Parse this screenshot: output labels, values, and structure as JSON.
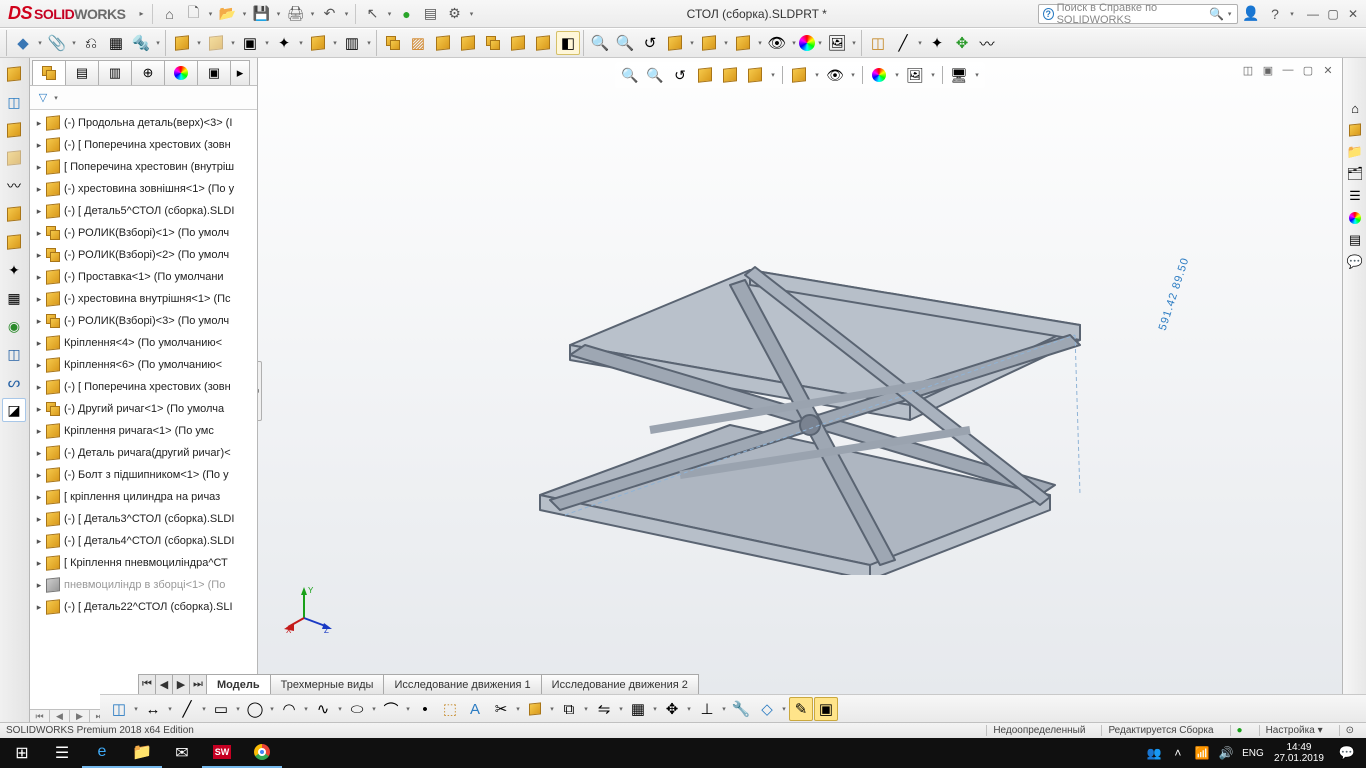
{
  "app": {
    "brand_solid": "SOLID",
    "brand_works": "WORKS",
    "title": "СТОЛ (сборка).SLDPRT *",
    "search_placeholder": "Поиск в Справке по SOLIDWORKS"
  },
  "tree": {
    "items": [
      {
        "t": "(-) Продольна деталь(верх)<3> (I",
        "asm": false
      },
      {
        "t": "(-) [ Поперечина хрестових (зовн",
        "asm": false
      },
      {
        "t": "[ Поперечина хрестовин (внутріш",
        "asm": false
      },
      {
        "t": "(-) хрестовина зовнішня<1> (По у",
        "asm": false
      },
      {
        "t": "(-) [ Деталь5^СТОЛ (сборка).SLDI",
        "asm": false
      },
      {
        "t": "(-) РОЛИК(Взборі)<1> (По умолч",
        "asm": true
      },
      {
        "t": "(-) РОЛИК(Взборі)<2> (По умолч",
        "asm": true
      },
      {
        "t": "(-) Проставка<1> (По умолчани",
        "asm": false
      },
      {
        "t": "(-) хрестовина внутрішня<1> (Пс",
        "asm": false
      },
      {
        "t": "(-) РОЛИК(Взборі)<3> (По умолч",
        "asm": true
      },
      {
        "t": "Кріплення<4> (По умолчанию<",
        "asm": false
      },
      {
        "t": "Кріплення<6> (По умолчанию<",
        "asm": false
      },
      {
        "t": "(-) [ Поперечина хрестових (зовн",
        "asm": false
      },
      {
        "t": "(-) Другий ричаг<1> (По умолча",
        "asm": true
      },
      {
        "t": "Кріплення ричага<1> (По умс",
        "asm": false
      },
      {
        "t": "(-) Деталь ричага(другий ричаг)<",
        "asm": false
      },
      {
        "t": "(-) Болт з підшипником<1> (По у",
        "asm": false
      },
      {
        "t": "[ кріплення цилиндра на ричаз",
        "asm": false
      },
      {
        "t": "(-) [ Деталь3^СТОЛ (сборка).SLDI",
        "asm": false
      },
      {
        "t": "(-) [ Деталь4^СТОЛ (сборка).SLDI",
        "asm": false
      },
      {
        "t": "[ Кріплення пневмоциліндра^СТ",
        "asm": false
      },
      {
        "t": "пневмоциліндр в зборці<1> (По",
        "asm": false,
        "grey": true
      },
      {
        "t": "(-) [ Деталь22^СТОЛ (сборка).SLI",
        "asm": false
      }
    ]
  },
  "btabs": {
    "model": "Модель",
    "views3d": "Трехмерные виды",
    "study1": "Исследование движения 1",
    "study2": "Исследование движения 2"
  },
  "status": {
    "edition": "SOLIDWORKS Premium 2018 x64 Edition",
    "state": "Недоопределенный",
    "edit": "Редактируется Сборка",
    "custom": "Настройка"
  },
  "dim_value": "591.42 89.50",
  "taskbar": {
    "lang": "ENG",
    "time": "14:49",
    "date": "27.01.2019"
  }
}
